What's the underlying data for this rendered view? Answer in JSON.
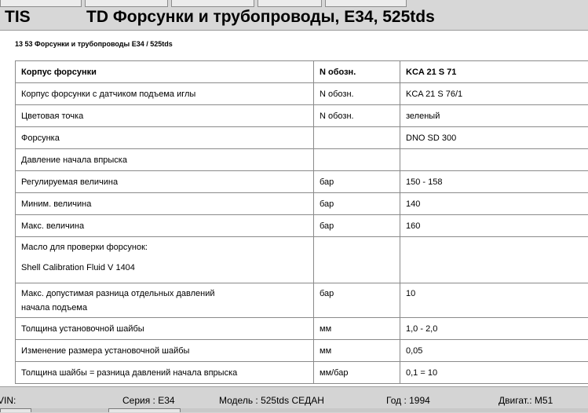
{
  "header": {
    "app_name": "TIS",
    "title": "TD  Форсунки и трубопроводы, E34, 525tds"
  },
  "document": {
    "heading": "13 53 Форсунки и трубопроводы E34 / 525tds",
    "rows": [
      {
        "name": "Корпус форсунки",
        "unit": "N обозн.",
        "value": "KCA 21 S 71"
      },
      {
        "name": "Корпус форсунки с датчиком подъема иглы",
        "unit": "N обозн.",
        "value": "KCA 21 S 76/1"
      },
      {
        "name": "Цветовая точка",
        "unit": "N обозн.",
        "value": "зеленый"
      },
      {
        "name": "Форсунка",
        "unit": "",
        "value": "DNO SD 300"
      },
      {
        "name": "Давление начала впрыска",
        "unit": "",
        "value": ""
      },
      {
        "name": "Регулируемая величина",
        "unit": "бар",
        "value": "150 - 158"
      },
      {
        "name": "Миним. величина",
        "unit": "бар",
        "value": "140"
      },
      {
        "name": "Макс. величина",
        "unit": "бар",
        "value": "160"
      },
      {
        "name": "Масло для проверки форсунок:",
        "name2": "Shell Calibration Fluid V 1404",
        "unit": "",
        "value": ""
      },
      {
        "name": "Макс. допустимая разница отдельных давлений",
        "name2": "начала подъема",
        "unit": "бар",
        "value": "10"
      },
      {
        "name": "Толщина установочной шайбы",
        "unit": "мм",
        "value": "1,0 - 2,0"
      },
      {
        "name": "Изменение размера установочной шайбы",
        "unit": "мм",
        "value": "0,05"
      },
      {
        "name": "Толщина шайбы = разница давлений начала впрыска",
        "unit": "мм/бар",
        "value": "0,1 = 10"
      }
    ]
  },
  "status": {
    "vin": "VIN:",
    "series": "Серия : E34",
    "model": "Модель : 525tds СЕДАН",
    "year": "Год : 1994",
    "engine": "Двигат.: M51"
  }
}
